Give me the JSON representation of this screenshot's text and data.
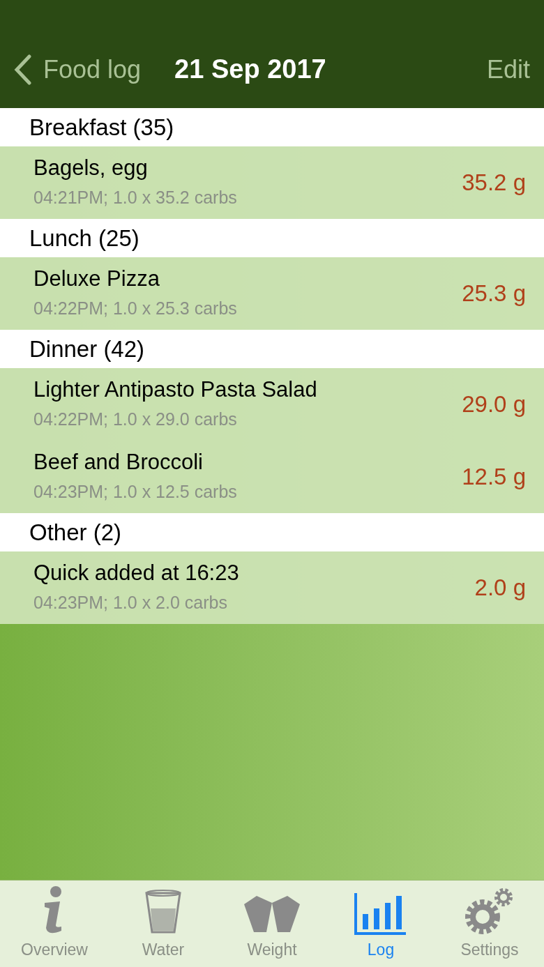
{
  "nav": {
    "back_label": "Food log",
    "title": "21 Sep 2017",
    "action": "Edit"
  },
  "sections": [
    {
      "title": "Breakfast (35)",
      "items": [
        {
          "name": "Bagels, egg",
          "detail": "04:21PM; 1.0 x 35.2 carbs",
          "amount": "35.2 g"
        }
      ]
    },
    {
      "title": "Lunch (25)",
      "items": [
        {
          "name": "Deluxe Pizza",
          "detail": "04:22PM; 1.0 x 25.3 carbs",
          "amount": "25.3 g"
        }
      ]
    },
    {
      "title": "Dinner (42)",
      "items": [
        {
          "name": "Lighter Antipasto Pasta Salad",
          "detail": "04:22PM; 1.0 x 29.0 carbs",
          "amount": "29.0 g"
        },
        {
          "name": "Beef and Broccoli",
          "detail": "04:23PM; 1.0 x 12.5 carbs",
          "amount": "12.5 g"
        }
      ]
    },
    {
      "title": "Other (2)",
      "items": [
        {
          "name": "Quick added at 16:23",
          "detail": "04:23PM; 1.0 x 2.0 carbs",
          "amount": "2.0 g"
        }
      ]
    }
  ],
  "tabs": [
    {
      "label": "Overview",
      "kind": "info",
      "selected": false
    },
    {
      "label": "Water",
      "kind": "glass",
      "selected": false
    },
    {
      "label": "Weight",
      "kind": "weight",
      "selected": false
    },
    {
      "label": "Log",
      "kind": "chart",
      "selected": true
    },
    {
      "label": "Settings",
      "kind": "gears",
      "selected": false
    }
  ]
}
